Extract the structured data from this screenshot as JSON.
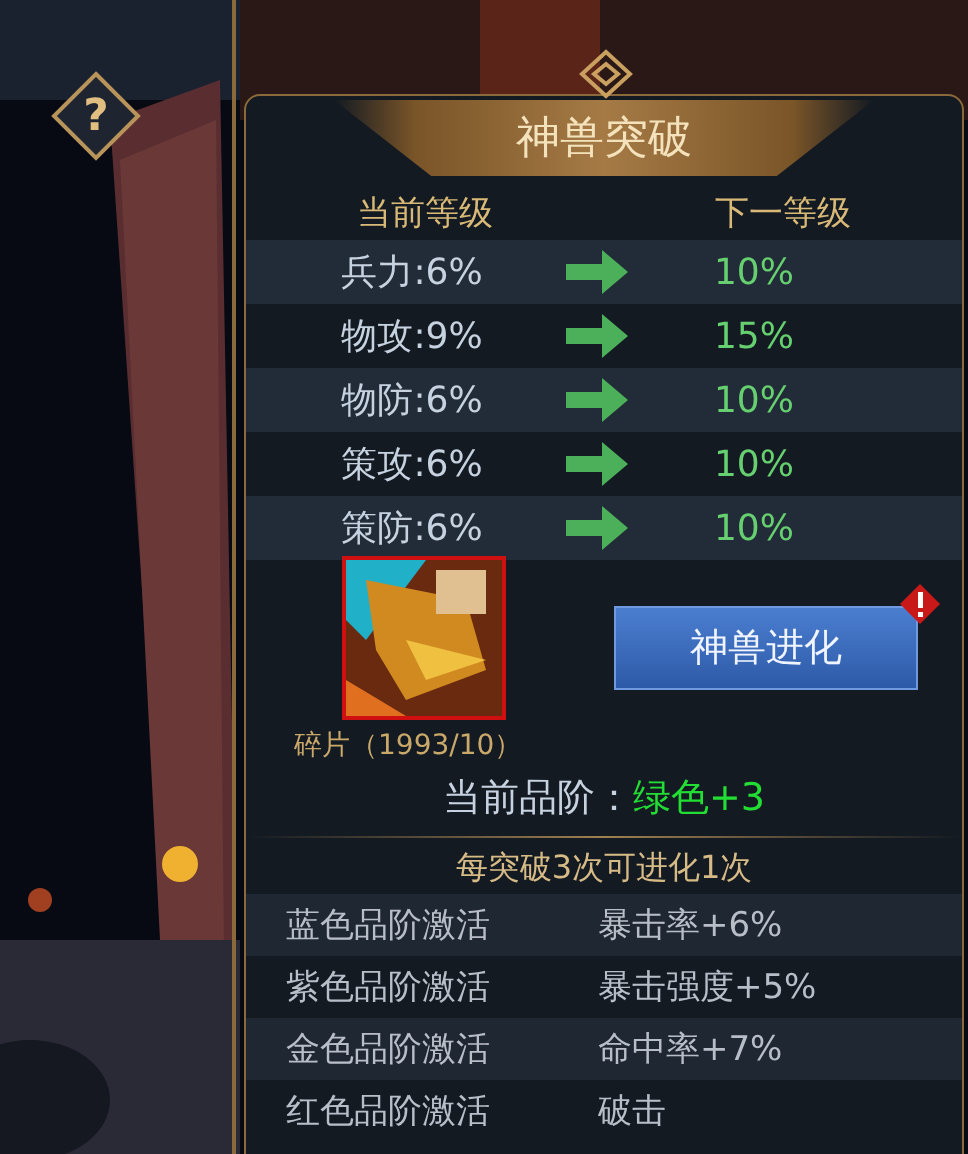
{
  "help_button": {
    "label": "?"
  },
  "panel": {
    "title": "神兽突破",
    "columns": [
      "当前等级",
      "下一等级"
    ],
    "stats": [
      {
        "current": "兵力:6%",
        "next": "10%"
      },
      {
        "current": "物攻:9%",
        "next": "15%"
      },
      {
        "current": "物防:6%",
        "next": "10%"
      },
      {
        "current": "策攻:6%",
        "next": "10%"
      },
      {
        "current": "策防:6%",
        "next": "10%"
      }
    ],
    "item": {
      "caption": "碎片（1993/10）"
    },
    "evolve_button": {
      "label": "神兽进化",
      "alert": true
    },
    "quality": {
      "label": "当前品阶：",
      "value": "绿色+3",
      "color": "#22dd33"
    },
    "note": "每突破3次可进化1次",
    "bonuses": [
      {
        "label": "蓝色品阶激活",
        "value": "暴击率+6%"
      },
      {
        "label": "紫色品阶激活",
        "value": "暴击强度+5%"
      },
      {
        "label": "金色品阶激活",
        "value": "命中率+7%"
      },
      {
        "label": "红色品阶激活",
        "value": "破击"
      }
    ]
  }
}
